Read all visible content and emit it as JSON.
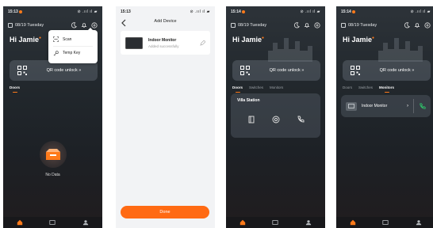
{
  "colors": {
    "accent": "#ff7a1a",
    "call_green": "#2fc36a",
    "done_button": "#ff6a13"
  },
  "screen1": {
    "status_time": "15:13",
    "status_icons": "⊘ .ııl ıl ▰",
    "date": "08/19 Tuesday",
    "greeting": "Hi Jamie",
    "qr_label": "QR code unlock",
    "menu": [
      {
        "label": "Scan",
        "icon": "scan-icon"
      },
      {
        "label": "Temp Key",
        "icon": "key-icon"
      }
    ],
    "tabs": [
      {
        "label": "Doors",
        "active": true
      }
    ],
    "empty_text": "No Data",
    "nav": [
      {
        "label": "Home",
        "icon": "home-icon",
        "active": true
      },
      {
        "label": "Devices",
        "icon": "devices-icon"
      },
      {
        "label": "Me",
        "icon": "profile-icon"
      }
    ]
  },
  "screen2": {
    "status_time": "15:13",
    "status_icons": "⊘ .ııl ıl ▰",
    "title": "Add Device",
    "device_name": "Indoor Monitor",
    "device_status": "Added successfully",
    "done_label": "Done"
  },
  "screen3": {
    "status_time": "15:14",
    "status_icons": "⊘ .ııl ıl ▰",
    "date": "08/19 Tuesday",
    "greeting": "Hi Jamie",
    "qr_label": "QR code unlock",
    "tabs": [
      {
        "label": "Doors",
        "active": true
      },
      {
        "label": "Switches"
      },
      {
        "label": "Monitors"
      }
    ],
    "station_title": "Villa Station",
    "station_actions": [
      "door-icon",
      "camera-icon",
      "call-icon"
    ]
  },
  "screen4": {
    "status_time": "15:14",
    "status_icons": "⊘ .ııl ıl ▰",
    "date": "08/19 Tuesday",
    "greeting": "Hi Jamie",
    "qr_label": "QR code unlock",
    "tabs": [
      {
        "label": "Doors"
      },
      {
        "label": "Switches"
      },
      {
        "label": "Monitors",
        "active": true
      }
    ],
    "monitor_name": "Indoor Monitor"
  }
}
